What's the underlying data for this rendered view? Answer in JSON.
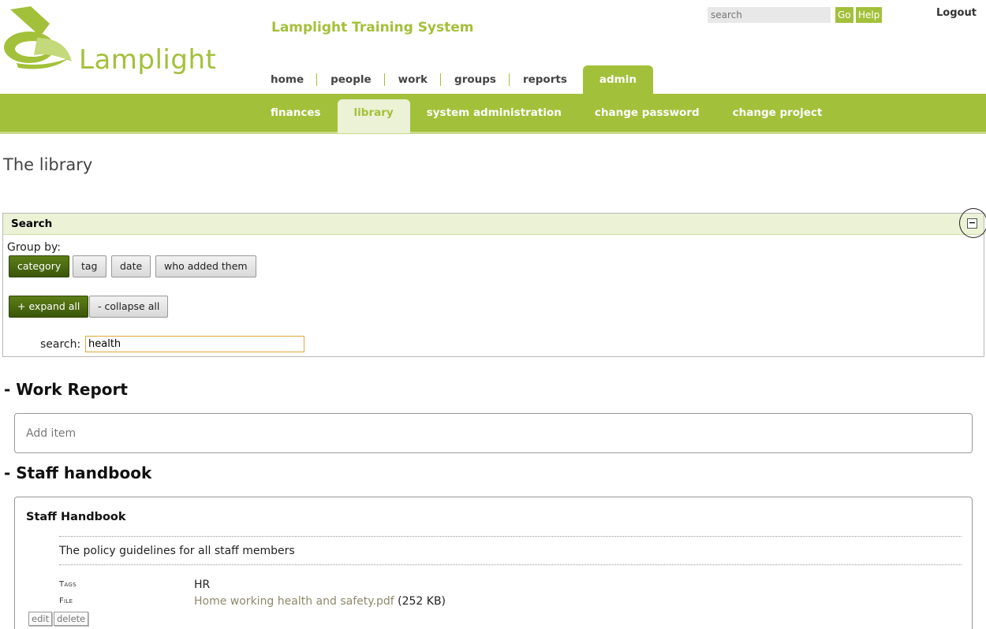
{
  "header": {
    "logo_text": "Lamplight",
    "app_title": "Lamplight Training System",
    "search_placeholder": "search",
    "go_label": "Go",
    "help_label": "Help",
    "logout_label": "Logout"
  },
  "main_nav": [
    {
      "label": "home"
    },
    {
      "label": "people"
    },
    {
      "label": "work"
    },
    {
      "label": "groups"
    },
    {
      "label": "reports"
    },
    {
      "label": "admin",
      "active": true
    }
  ],
  "sub_nav": [
    {
      "label": "finances"
    },
    {
      "label": "library",
      "active": true
    },
    {
      "label": "system administration"
    },
    {
      "label": "change password"
    },
    {
      "label": "change project"
    }
  ],
  "page": {
    "title": "The library"
  },
  "search_panel": {
    "title": "Search",
    "collapse_symbol": "−",
    "group_by_label": "Group by:",
    "group_buttons": [
      "category",
      "tag",
      "date",
      "who added them"
    ],
    "selected_group": "category",
    "expand_label": "+ expand all",
    "collapse_label": "- collapse all",
    "search_label": "search:",
    "search_value": "health"
  },
  "sections": [
    {
      "heading": "- Work Report",
      "add_item_label": "Add item"
    },
    {
      "heading": "- Staff handbook",
      "document": {
        "title": "Staff Handbook",
        "description": "The policy guidelines for all staff members",
        "tags_key": "Tags",
        "tags_value": "HR",
        "file_key": "File",
        "file_name": "Home working health and safety.pdf",
        "file_size": "(252 KB)",
        "edit_label": "edit",
        "delete_label": "delete"
      }
    }
  ],
  "colors": {
    "brand_green": "#a3c03a",
    "active_tab_bg": "#ebf2d6",
    "dark_button": "#4a6a10"
  }
}
